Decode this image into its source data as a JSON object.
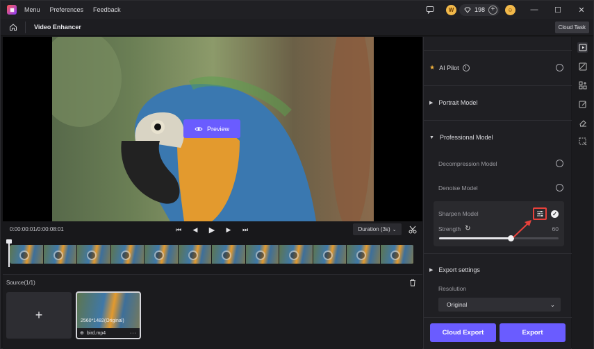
{
  "titlebar": {
    "menu": [
      "Menu",
      "Preferences",
      "Feedback"
    ],
    "credits": "198"
  },
  "subbar": {
    "title": "Video Enhancer",
    "cloud_task": "Cloud Task"
  },
  "preview": {
    "button_label": "Preview"
  },
  "playback": {
    "timecode": "0:00:00:01/0:00:08:01",
    "duration_label": "Duration (3s)"
  },
  "source": {
    "label": "Source(1/1)",
    "add_label": "+",
    "items": [
      {
        "resolution": "2560*1482(Original)",
        "filename": "bird.mp4"
      }
    ]
  },
  "panel": {
    "ai_pilot": "AI Pilot",
    "portrait_model": "Portrait Model",
    "professional_model": "Professional Model",
    "decompression_model": "Decompression Model",
    "denoise_model": "Denoise Model",
    "sharpen_model": "Sharpen Model",
    "strength_label": "Strength",
    "strength_value": "60",
    "strength_level": 0.6,
    "export_settings": "Export settings",
    "resolution_label": "Resolution",
    "resolution_value": "Original",
    "cloud_export": "Cloud Export",
    "export": "Export"
  },
  "colors": {
    "accent": "#6a5cff",
    "highlight": "#e8413b",
    "star": "#f3b33d"
  }
}
